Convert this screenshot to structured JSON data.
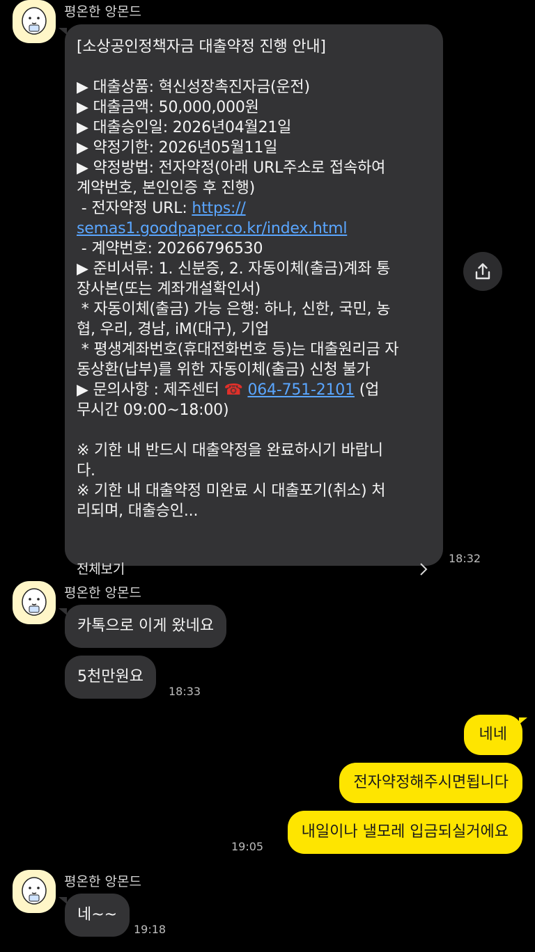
{
  "sender_name": "평온한 앙몬드",
  "card": {
    "lines": [
      "[소상공인정책자금 대출약정 진행 안내]",
      "",
      "▶ 대출상품: 혁신성장촉진자금(운전)",
      "▶ 대출금액: 50,000,000원",
      "▶ 대출승인일: 2026년04월21일",
      "▶ 약정기한: 2026년05월11일",
      "▶ 약정방법: 전자약정(아래 URL주소로 접속하여",
      "계약번호, 본인인증 후 진행)"
    ],
    "url_label": " - 전자약정 URL: ",
    "url_part1": "https://",
    "url_part2": "semas1.goodpaper.co.kr/index.html",
    "lines2": [
      " - 계약번호: 20266796530",
      "▶ 준비서류: 1. 신분증, 2. 자동이체(출금)계좌 통",
      "장사본(또는 계좌개설확인서)",
      " * 자동이체(출금) 가능 은행: 하나, 신한, 국민, 농",
      "협, 우리, 경남, iM(대구), 기업",
      " * 평생계좌번호(휴대전화번호 등)는 대출원리금 자",
      "동상환(납부)를 위한 자동이체(출금) 신청 불가"
    ],
    "contact_prefix": "▶ 문의사항 : 제주센터 ",
    "phone_icon": "☎",
    "phone": "064-751-2101",
    "contact_suffix": " (업",
    "lines3": [
      "무시간 09:00~18:00)",
      "",
      "※ 기한 내 반드시 대출약정을 완료하시기 바랍니",
      "다.",
      "※ 기한 내 대출약정 미완료 시 대출포기(취소) 처",
      "리되며, 대출승인..."
    ],
    "see_all": "전체보기",
    "time": "18:32"
  },
  "messages": {
    "in1": "카톡으로 이게 왔네요",
    "in2": "5천만원요",
    "in2_time": "18:33",
    "out1": "네네",
    "out2": "전자약정해주시면됩니다",
    "out3": "내일이나 낼모레 입금되실거에요",
    "out_time": "19:05",
    "in3": "네~~",
    "in3_time": "19:18"
  },
  "icons": {
    "share": "share-icon",
    "avatar": "almond-avatar-icon",
    "chevron": "chevron-right-icon",
    "phone": "telephone-icon"
  },
  "colors": {
    "background": "#000000",
    "incoming_bubble": "#333335",
    "outgoing_bubble": "#fee500",
    "link": "#5aa6ff",
    "phone_icon": "#e0302a"
  }
}
